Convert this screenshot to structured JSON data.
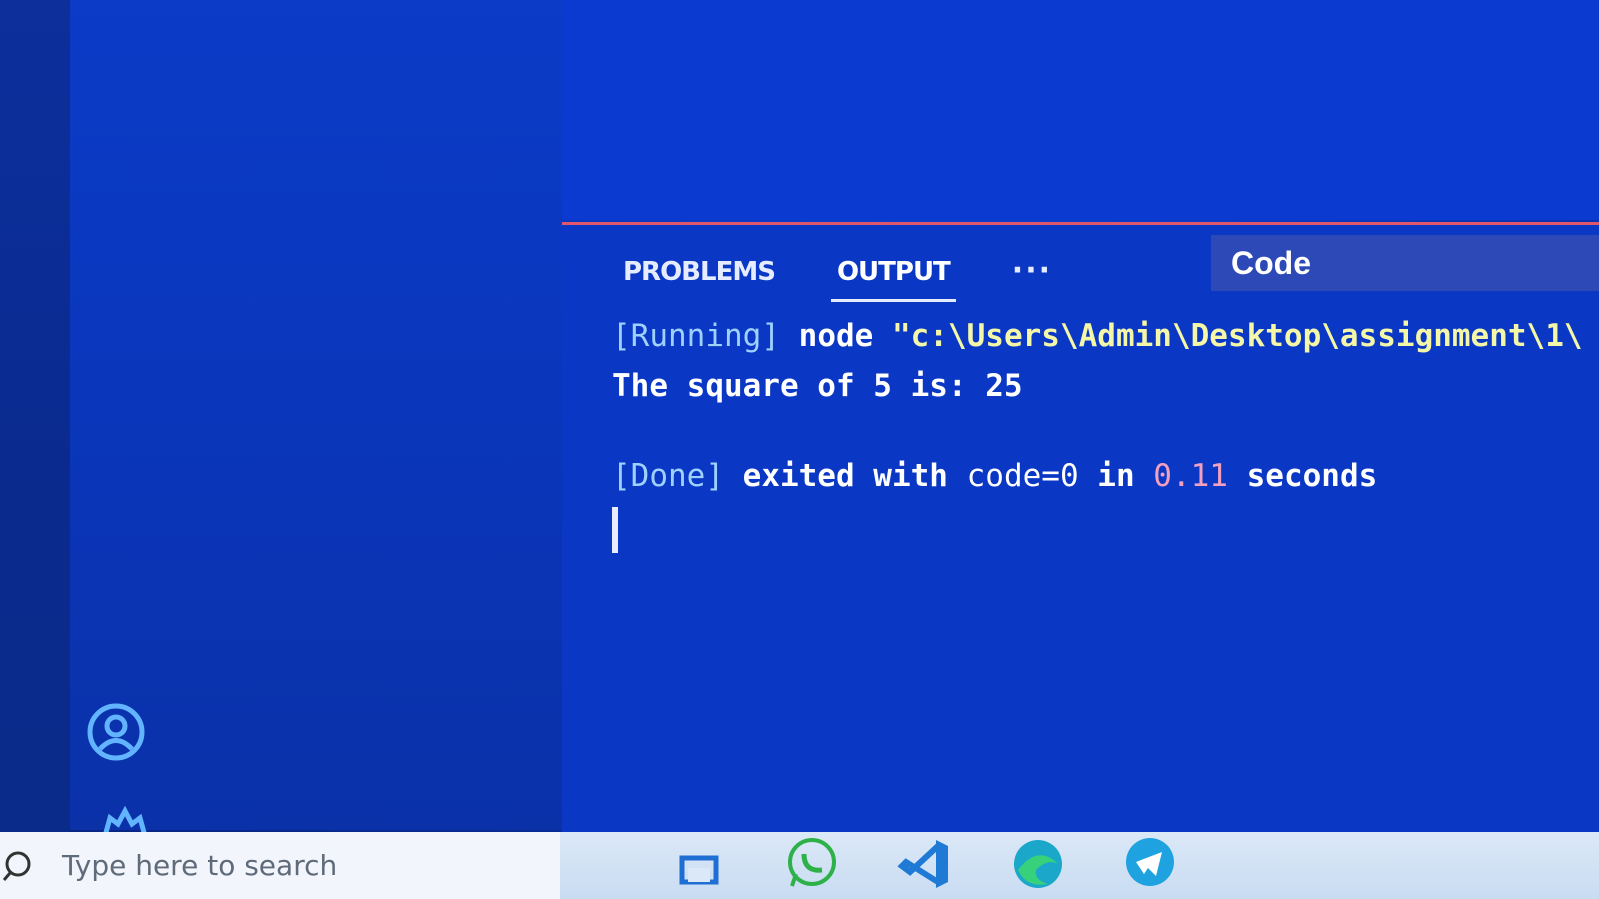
{
  "panel": {
    "tabs": [
      {
        "label": "PROBLEMS",
        "active": false
      },
      {
        "label": "OUTPUT",
        "active": true
      },
      {
        "label": "···",
        "active": false
      }
    ],
    "channel": "Code"
  },
  "output": {
    "line1": {
      "tag": "[Running]",
      "cmd": "node",
      "path": "\"c:\\Users\\Admin\\Desktop\\assignment\\1\\"
    },
    "line2": "The square of 5 is: 25",
    "line3": {
      "tag": "[Done]",
      "text1": "exited with",
      "code": "code=0",
      "in": "in",
      "time": "0.11",
      "seconds": "seconds"
    }
  },
  "taskbar": {
    "search_placeholder": "Type here to search",
    "apps": [
      "file-explorer-icon",
      "whatsapp-icon",
      "vscode-icon",
      "edge-icon",
      "telegram-icon"
    ]
  },
  "colors": {
    "accent_border": "#e0566d",
    "panel_bg": "#0a37c4"
  }
}
